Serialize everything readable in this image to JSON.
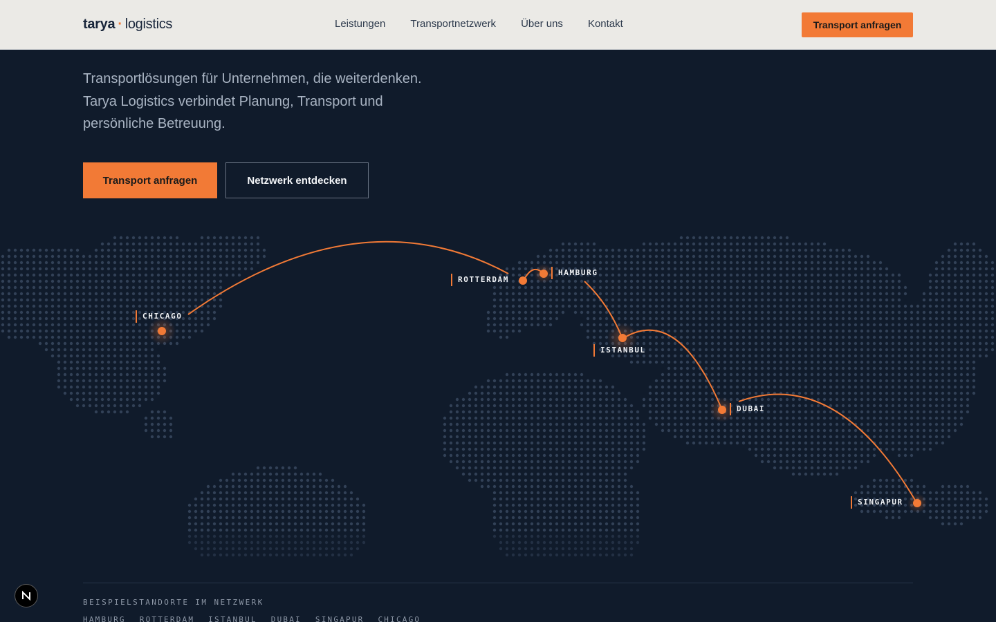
{
  "header": {
    "logo_brand": "tarya",
    "logo_separator": "·",
    "logo_suffix": "logistics",
    "nav": [
      "Leistungen",
      "Transportnetzwerk",
      "Über uns",
      "Kontakt"
    ],
    "cta_label": "Transport anfragen"
  },
  "hero": {
    "lead_lines": [
      "Transportlösungen für Unternehmen, die weiterdenken.",
      "Tarya Logistics verbindet Planung, Transport und",
      "persönliche Betreuung."
    ],
    "primary_button": "Transport anfragen",
    "secondary_button": "Netzwerk entdecken"
  },
  "map": {
    "cities": {
      "chicago": "CHICAGO",
      "rotterdam": "ROTTERDAM",
      "hamburg": "HAMBURG",
      "istanbul": "ISTANBUL",
      "dubai": "DUBAI",
      "singapur": "SINGAPUR"
    }
  },
  "footer": {
    "section_label": "BEISPIELSTANDORTE IM NETZWERK",
    "locations": [
      "HAMBURG",
      "ROTTERDAM",
      "ISTANBUL",
      "DUBAI",
      "SINGAPUR",
      "CHICAGO"
    ]
  },
  "colors": {
    "accent": "#f27a36",
    "background": "#101b2b",
    "header_bg": "#ebeae6",
    "dots": "#3b4b63"
  },
  "icons": {
    "badge": "n-logo-icon"
  }
}
